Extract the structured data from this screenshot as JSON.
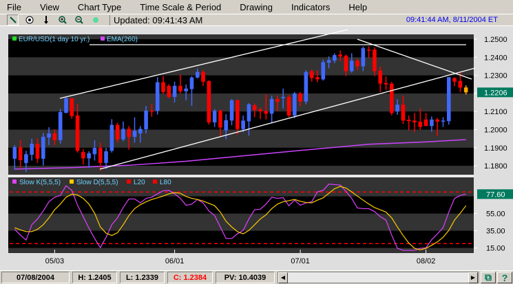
{
  "menu": [
    "File",
    "View",
    "Chart Type",
    "Time Scale & Period",
    "Drawing",
    "Indicators",
    "Help"
  ],
  "toolbar": {
    "icons": [
      "draw-line-icon",
      "crosshair-icon",
      "down-arrow-icon",
      "zoom-in-icon",
      "zoom-out-icon",
      "green-dot-icon"
    ],
    "updated": "Updated: 09:41:43 AM",
    "clock": "09:41:44 AM, 8/11/2004 ET"
  },
  "colors": {
    "up": "#4169ff",
    "down": "#ff0000",
    "current": "#ffa500",
    "ema": "#cc44ff",
    "slow_k": "#e040ff",
    "slow_d": "#ffcc00",
    "level": "#ff0000",
    "highlight": "#007a5e"
  },
  "chart_data": [
    {
      "type": "candlestick",
      "legend": [
        {
          "label": "EUR/USD(1 day  10 yr.)",
          "color": "#22dd22"
        },
        {
          "label": "EMA(260)",
          "color": "#cc44ff"
        }
      ],
      "yticks": [
        "1.2500",
        "1.2400",
        "1.2300",
        "1.2200",
        "1.2100",
        "1.2000",
        "1.1900",
        "1.1800"
      ],
      "ylim": [
        1.175,
        1.253
      ],
      "last_price": "1.2206",
      "xticks": [
        {
          "label": "05/03",
          "index": 7
        },
        {
          "label": "06/01",
          "index": 28
        },
        {
          "label": "07/01",
          "index": 50
        },
        {
          "label": "08/02",
          "index": 72
        }
      ],
      "ohlc": [
        [
          1.1839,
          1.1914,
          1.1778,
          1.1903
        ],
        [
          1.1903,
          1.1943,
          1.1788,
          1.1831
        ],
        [
          1.1815,
          1.1883,
          1.1765,
          1.1864
        ],
        [
          1.1861,
          1.195,
          1.1829,
          1.1922
        ],
        [
          1.1922,
          1.1952,
          1.1816,
          1.1839
        ],
        [
          1.1839,
          1.1982,
          1.1801,
          1.196
        ],
        [
          1.1956,
          1.2013,
          1.1915,
          1.1979
        ],
        [
          1.1979,
          1.2002,
          1.1915,
          1.1942
        ],
        [
          1.1942,
          1.2115,
          1.1923,
          1.2097
        ],
        [
          1.2093,
          1.2179,
          1.209,
          1.2173
        ],
        [
          1.2173,
          1.2173,
          1.2061,
          1.2075
        ],
        [
          1.2078,
          1.2141,
          1.1873,
          1.1883
        ],
        [
          1.1876,
          1.1892,
          1.1807,
          1.1841
        ],
        [
          1.1841,
          1.188,
          1.1788,
          1.1869
        ],
        [
          1.1864,
          1.1941,
          1.1829,
          1.1899
        ],
        [
          1.1899,
          1.1928,
          1.1771,
          1.1816
        ],
        [
          1.1816,
          1.1899,
          1.1782,
          1.188
        ],
        [
          1.1883,
          1.2058,
          1.1873,
          1.2026
        ],
        [
          1.2026,
          1.2039,
          1.1928,
          1.1946
        ],
        [
          1.1946,
          1.2045,
          1.1936,
          1.2004
        ],
        [
          1.2004,
          1.202,
          1.1889,
          1.196
        ],
        [
          1.196,
          1.2068,
          1.1928,
          1.1994
        ],
        [
          1.1979,
          1.202,
          1.1928,
          1.2004
        ],
        [
          1.2002,
          1.2131,
          1.1979,
          1.2105
        ],
        [
          1.2105,
          1.2143,
          1.2071,
          1.2101
        ],
        [
          1.2104,
          1.229,
          1.2083,
          1.2262
        ],
        [
          1.2262,
          1.2296,
          1.2198,
          1.2208
        ],
        [
          1.2242,
          1.2251,
          1.2174,
          1.2181
        ],
        [
          1.2181,
          1.2265,
          1.215,
          1.2242
        ],
        [
          1.2242,
          1.2306,
          1.22,
          1.2212
        ],
        [
          1.2212,
          1.225,
          1.2162,
          1.2227
        ],
        [
          1.2224,
          1.2296,
          1.2131,
          1.2288
        ],
        [
          1.2288,
          1.2338,
          1.2283,
          1.2319
        ],
        [
          1.2319,
          1.2329,
          1.2242,
          1.2265
        ],
        [
          1.2269,
          1.2272,
          1.2028,
          1.204
        ],
        [
          1.204,
          1.2114,
          1.2015,
          1.2104
        ],
        [
          1.2104,
          1.2112,
          1.196,
          1.2012
        ],
        [
          1.1996,
          1.2085,
          1.1947,
          1.2052
        ],
        [
          1.205,
          1.2169,
          1.2024,
          1.2162
        ],
        [
          1.2163,
          1.2165,
          1.1973,
          1.2003
        ],
        [
          1.2003,
          1.2078,
          1.1986,
          1.205
        ],
        [
          1.2046,
          1.2146,
          1.1967,
          1.214
        ],
        [
          1.2135,
          1.2144,
          1.2069,
          1.2108
        ],
        [
          1.2112,
          1.2123,
          1.2059,
          1.2101
        ],
        [
          1.2104,
          1.2194,
          1.2056,
          1.2088
        ],
        [
          1.2088,
          1.2188,
          1.2037,
          1.2169
        ],
        [
          1.2169,
          1.2188,
          1.2104,
          1.2154
        ],
        [
          1.2174,
          1.2227,
          1.2117,
          1.2181
        ],
        [
          1.2181,
          1.2191,
          1.2069,
          1.2078
        ],
        [
          1.2078,
          1.2208,
          1.2063,
          1.22
        ],
        [
          1.22,
          1.2208,
          1.2129,
          1.2155
        ],
        [
          1.2155,
          1.2328,
          1.214,
          1.2319
        ],
        [
          1.2323,
          1.2332,
          1.2265,
          1.2285
        ],
        [
          1.229,
          1.2329,
          1.2262,
          1.2278
        ],
        [
          1.2278,
          1.2387,
          1.2271,
          1.2373
        ],
        [
          1.237,
          1.2405,
          1.2339,
          1.2384
        ],
        [
          1.2381,
          1.2422,
          1.2367,
          1.2412
        ],
        [
          1.2415,
          1.2438,
          1.2377,
          1.2404
        ],
        [
          1.2408,
          1.2415,
          1.2296,
          1.2323
        ],
        [
          1.2323,
          1.2422,
          1.2315,
          1.2381
        ],
        [
          1.2381,
          1.2392,
          1.2328,
          1.235
        ],
        [
          1.235,
          1.246,
          1.2323,
          1.245
        ],
        [
          1.2442,
          1.246,
          1.2396,
          1.244
        ],
        [
          1.2442,
          1.2455,
          1.2296,
          1.2323
        ],
        [
          1.2327,
          1.2349,
          1.2208,
          1.2254
        ],
        [
          1.2258,
          1.2294,
          1.2219,
          1.225
        ],
        [
          1.2254,
          1.2264,
          1.2079,
          1.2092
        ],
        [
          1.21,
          1.2169,
          1.2082,
          1.2138
        ],
        [
          1.2138,
          1.2188,
          1.2031,
          1.205
        ],
        [
          1.2054,
          1.2078,
          1.1995,
          1.2047
        ],
        [
          1.205,
          1.2092,
          1.1986,
          1.204
        ],
        [
          1.2044,
          1.2117,
          1.1999,
          1.2015
        ],
        [
          1.2056,
          1.2092,
          1.202,
          1.202
        ],
        [
          1.202,
          1.2073,
          1.1988,
          1.2056
        ],
        [
          1.2056,
          1.2065,
          1.1964,
          1.2044
        ],
        [
          1.2044,
          1.2069,
          1.2015,
          1.205
        ],
        [
          1.2047,
          1.229,
          1.2028,
          1.229
        ],
        [
          1.2285,
          1.229,
          1.224,
          1.2265
        ],
        [
          1.227,
          1.2318,
          1.2206,
          1.2232
        ],
        [
          1.2233,
          1.2245,
          1.2194,
          1.2206
        ]
      ],
      "ema": [
        [
          0,
          1.1782
        ],
        [
          10,
          1.179
        ],
        [
          20,
          1.1803
        ],
        [
          30,
          1.1825
        ],
        [
          40,
          1.1855
        ],
        [
          50,
          1.1885
        ],
        [
          62,
          1.1919
        ],
        [
          72,
          1.1932
        ],
        [
          79,
          1.1945
        ]
      ]
    },
    {
      "type": "line",
      "legend": [
        {
          "label": "Slow K(5,5,5)",
          "color": "#e040ff"
        },
        {
          "label": "Slow D(5,5,5)",
          "color": "#ffcc00"
        },
        {
          "label": "L20",
          "color": "#ff0000"
        },
        {
          "label": "L80",
          "color": "#ff0000"
        }
      ],
      "yticks": [
        "55.00",
        "35.00",
        "15.00"
      ],
      "last_value": "77.60",
      "levels": [
        20,
        80
      ],
      "series": [
        {
          "name": "Slow K(5,5,5)",
          "values": [
            36.7,
            30,
            24.2,
            42,
            48.7,
            58,
            68.7,
            74,
            76,
            87.4,
            82,
            64.7,
            51.4,
            38,
            26,
            15.4,
            27.4,
            42,
            50,
            62,
            72,
            72,
            67.4,
            72.7,
            74,
            78,
            81.5,
            82,
            78,
            72.7,
            64.7,
            66,
            71.4,
            67.4,
            58,
            52.7,
            39.4,
            26,
            26,
            31.4,
            35.4,
            48.7,
            59.4,
            60,
            66,
            74,
            72.7,
            73.5,
            64.2,
            70.6,
            64.7,
            67.4,
            68.7,
            80.2,
            82,
            89.3,
            88.7,
            88.2,
            80.7,
            72.7,
            61.5,
            60.7,
            60.7,
            57.3,
            51.4,
            47.4,
            30,
            14.6,
            12.2,
            12.2,
            12.2,
            14.6,
            15.1,
            24.7,
            31.4,
            38.6,
            56.7,
            72.7,
            76,
            77.6
          ]
        },
        {
          "name": "Slow D(5,5,5)",
          "values": [
            38.6,
            36,
            34,
            34,
            36.7,
            42,
            50,
            59.4,
            66,
            74,
            77.5,
            76.7,
            72.7,
            66,
            55.4,
            39.4,
            32.2,
            29.5,
            32.7,
            42,
            52.7,
            60.7,
            65.3,
            68.7,
            71.4,
            73.3,
            75.4,
            78,
            79.4,
            78.6,
            74.9,
            72.7,
            71.4,
            69.5,
            66.9,
            64.2,
            56.7,
            46,
            39.4,
            34,
            31.4,
            35.4,
            42,
            48.7,
            53.5,
            60.7,
            66,
            68.7,
            70,
            71.4,
            69.3,
            67.9,
            67.4,
            70.6,
            73.3,
            78.6,
            83.9,
            86.6,
            84.7,
            80.2,
            75.4,
            70.6,
            66,
            62,
            59.4,
            56.7,
            50,
            39.4,
            29.5,
            20.7,
            14.6,
            12.7,
            14.6,
            18.1,
            22,
            27.4,
            35.4,
            47.4,
            55.4,
            64.2
          ]
        }
      ]
    }
  ],
  "status": {
    "date": "07/08/2004",
    "high": "H: 1.2405",
    "low": "L: 1.2339",
    "close": "C: 1.2384",
    "pv": "PV: 10.4039"
  }
}
